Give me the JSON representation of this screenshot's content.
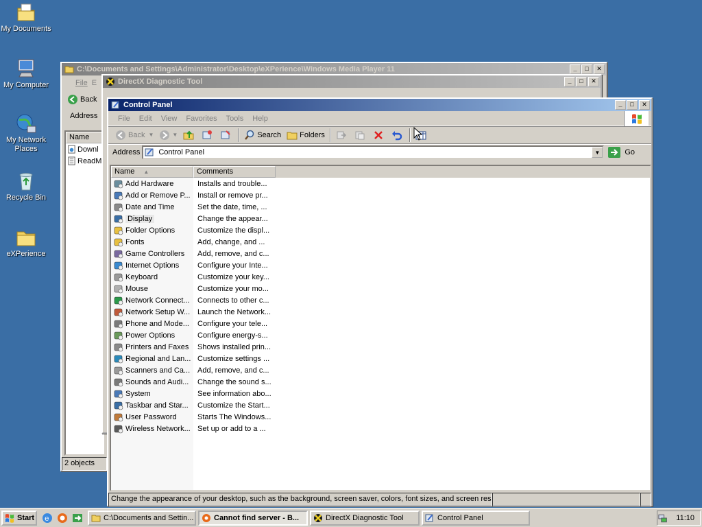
{
  "desktop": {
    "icons": [
      {
        "label": "My Documents"
      },
      {
        "label": "My Computer"
      },
      {
        "label": "My Network Places"
      },
      {
        "label": "Recycle Bin"
      },
      {
        "label": "eXPerience"
      }
    ]
  },
  "explorer_back": {
    "title": "C:\\Documents and Settings\\Administrator\\Desktop\\eXPerience\\Windows Media Player 11",
    "menu_file": "File",
    "menu_e": "E",
    "back_label": "Back",
    "address_label": "Address",
    "col_name": "Name",
    "items": [
      "Downl",
      "ReadM"
    ],
    "status": "2 objects"
  },
  "dxdiag": {
    "title": "DirectX Diagnostic Tool"
  },
  "control_panel": {
    "title": "Control Panel",
    "menu": [
      "File",
      "Edit",
      "View",
      "Favorites",
      "Tools",
      "Help"
    ],
    "toolbar": {
      "back": "Back",
      "search": "Search",
      "folders": "Folders"
    },
    "address_label": "Address",
    "address_value": "Control Panel",
    "go_label": "Go",
    "columns": {
      "name": "Name",
      "comments": "Comments"
    },
    "items": [
      {
        "name": "Add Hardware",
        "comment": "Installs and trouble...",
        "icon": "hardware-icon",
        "color": "#6b8e9e"
      },
      {
        "name": "Add or Remove P...",
        "comment": "Install or remove pr...",
        "icon": "add-remove-icon",
        "color": "#4a7ab8"
      },
      {
        "name": "Date and Time",
        "comment": "Set the date, time, ...",
        "icon": "clock-icon",
        "color": "#8a8a8a"
      },
      {
        "name": "Display",
        "comment": "Change the appear...",
        "icon": "display-icon",
        "color": "#3a6ea5"
      },
      {
        "name": "Folder Options",
        "comment": "Customize the displ...",
        "icon": "folder-icon",
        "color": "#e8c040"
      },
      {
        "name": "Fonts",
        "comment": "Add, change, and ...",
        "icon": "fonts-folder-icon",
        "color": "#e8c040"
      },
      {
        "name": "Game Controllers",
        "comment": "Add, remove, and c...",
        "icon": "joystick-icon",
        "color": "#7a6aa0"
      },
      {
        "name": "Internet Options",
        "comment": "Configure your Inte...",
        "icon": "globe-icon",
        "color": "#3a8ad0"
      },
      {
        "name": "Keyboard",
        "comment": "Customize your key...",
        "icon": "keyboard-icon",
        "color": "#9a9a9a"
      },
      {
        "name": "Mouse",
        "comment": "Customize your mo...",
        "icon": "mouse-icon",
        "color": "#b0b0b0"
      },
      {
        "name": "Network Connect...",
        "comment": "Connects to other c...",
        "icon": "network-globe-icon",
        "color": "#2a9a4a"
      },
      {
        "name": "Network Setup W...",
        "comment": "Launch the Network...",
        "icon": "network-house-icon",
        "color": "#c05a3a"
      },
      {
        "name": "Phone and Mode...",
        "comment": "Configure your tele...",
        "icon": "phone-icon",
        "color": "#7a7a7a"
      },
      {
        "name": "Power Options",
        "comment": "Configure energy-s...",
        "icon": "power-icon",
        "color": "#6a9a5a"
      },
      {
        "name": "Printers and Faxes",
        "comment": "Shows installed prin...",
        "icon": "printer-icon",
        "color": "#8a8a8a"
      },
      {
        "name": "Regional and Lan...",
        "comment": "Customize settings ...",
        "icon": "regional-globe-icon",
        "color": "#2a8aba"
      },
      {
        "name": "Scanners and Ca...",
        "comment": "Add, remove, and c...",
        "icon": "scanner-icon",
        "color": "#9a9a9a"
      },
      {
        "name": "Sounds and Audi...",
        "comment": "Change the sound s...",
        "icon": "speaker-icon",
        "color": "#7a7a7a"
      },
      {
        "name": "System",
        "comment": "See information abo...",
        "icon": "system-icon",
        "color": "#4a7ab8"
      },
      {
        "name": "Taskbar and Star...",
        "comment": "Customize the Start...",
        "icon": "taskbar-icon",
        "color": "#3a6ea5"
      },
      {
        "name": "User Password",
        "comment": "Starts The Windows...",
        "icon": "users-icon",
        "color": "#c07a3a"
      },
      {
        "name": "Wireless Network...",
        "comment": "Set up or add to a ...",
        "icon": "wireless-icon",
        "color": "#5a5a5a"
      }
    ],
    "status": "Change the appearance of your desktop, such as the background, screen saver, colors, font sizes, and screen reso"
  },
  "taskbar": {
    "start": "Start",
    "tasks": [
      {
        "label": "C:\\Documents and Settin..."
      },
      {
        "label": "Cannot find server - B..."
      },
      {
        "label": "DirectX Diagnostic Tool"
      },
      {
        "label": "Control Panel"
      }
    ],
    "clock": "11:10"
  }
}
